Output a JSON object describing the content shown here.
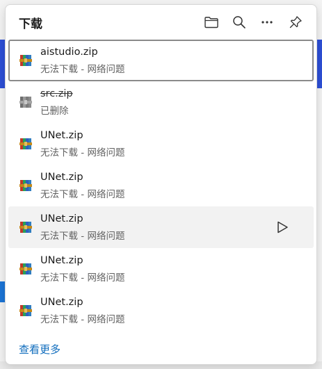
{
  "header": {
    "title": "下载",
    "icons": [
      "folder-icon",
      "search-icon",
      "more-icon",
      "pin-icon"
    ]
  },
  "items": [
    {
      "name": "aistudio.zip",
      "status": "无法下载 - 网络问题",
      "deleted": false
    },
    {
      "name": "src.zip",
      "status": "已删除",
      "deleted": true
    },
    {
      "name": "UNet.zip",
      "status": "无法下载 - 网络问题",
      "deleted": false
    },
    {
      "name": "UNet.zip",
      "status": "无法下载 - 网络问题",
      "deleted": false
    },
    {
      "name": "UNet.zip",
      "status": "无法下载 - 网络问题",
      "deleted": false
    },
    {
      "name": "UNet.zip",
      "status": "无法下载 - 网络问题",
      "deleted": false
    },
    {
      "name": "UNet.zip",
      "status": "无法下载 - 网络问题",
      "deleted": false
    }
  ],
  "footer": {
    "see_more": "查看更多"
  },
  "colors": {
    "accent": "#0f6cbd",
    "background_blue": "#2d4fd6"
  }
}
